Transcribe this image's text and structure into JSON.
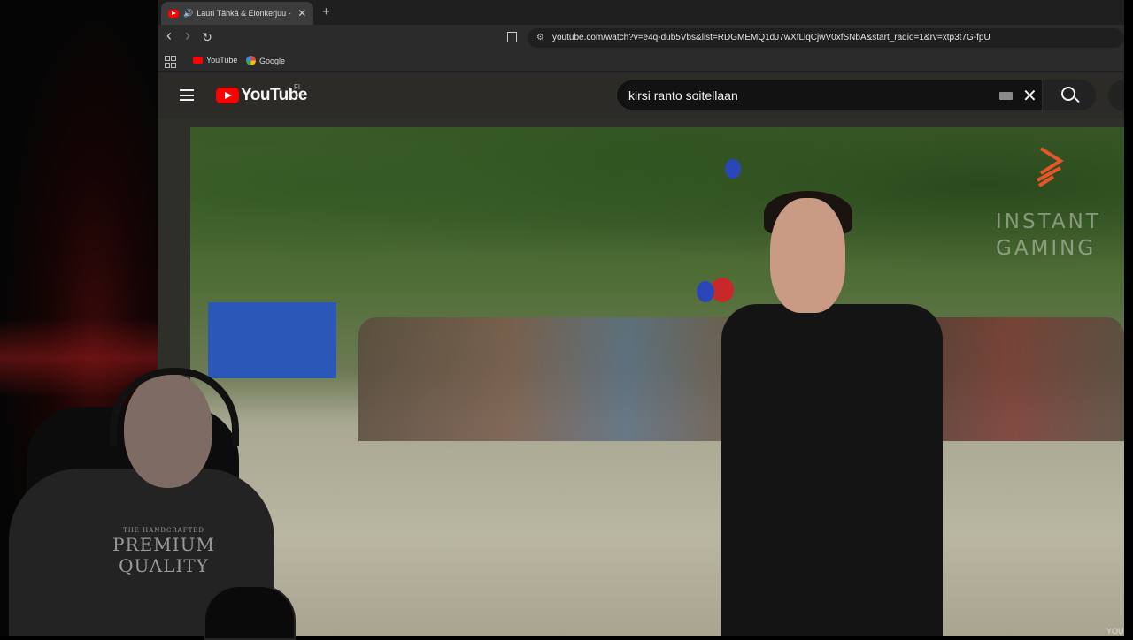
{
  "browser": {
    "tab": {
      "title": "Lauri Tähkä & Elonkerjuu - Su",
      "audio_icon": "speaker-icon",
      "close_label": "✕"
    },
    "new_tab_label": "+",
    "nav": {
      "back": "‹",
      "forward": "›",
      "reload": "↻"
    },
    "url": "youtube.com/watch?v=e4q-dub5Vbs&list=RDGMEMQ1dJ7wXfLlqCjwV0xfSNbA&start_radio=1&rv=xtp3t7G-fpU",
    "bookmarks": [
      {
        "label": "YouTube",
        "icon": "youtube-icon"
      },
      {
        "label": "Google",
        "icon": "google-icon"
      }
    ]
  },
  "youtube": {
    "logo_text": "YouTube",
    "country_code": "FI",
    "search_value": "kirsi ranto soitellaan",
    "brand_color": "#ff0000"
  },
  "video": {
    "watermark_line1": "INSTANT",
    "watermark_line2": "GAMING",
    "watermark_logo": "instant-gaming-logo",
    "corner_text": "YOU"
  },
  "webcam": {
    "shirt_small": "THE HANDCRAFTED",
    "shirt_line1": "PREMIUM",
    "shirt_line2": "QUALITY"
  }
}
